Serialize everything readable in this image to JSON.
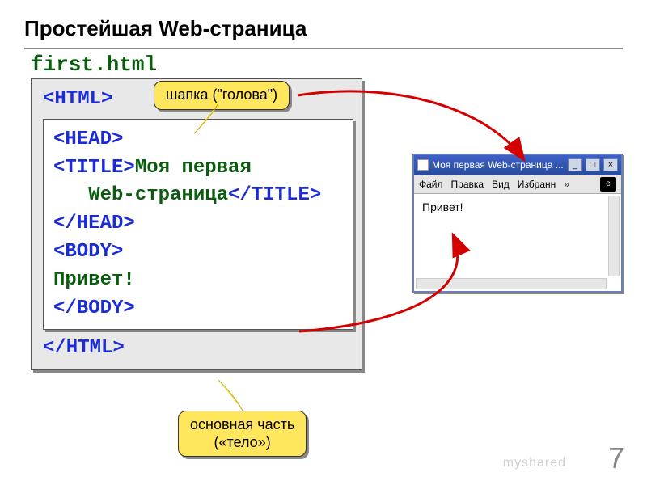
{
  "slide": {
    "title": "Простейшая Web-страница",
    "filename": "first.html",
    "page_number": "7",
    "watermark": "myshared"
  },
  "code": {
    "html_open": "<HTML>",
    "head_open": "<HEAD>",
    "title_open": "<TITLE>",
    "title_text_l1": "Моя первая",
    "title_text_l2": "Web-страница",
    "title_close": "</TITLE>",
    "head_close": "</HEAD>",
    "body_open": "<BODY>",
    "body_text": "Привет!",
    "body_close": "</BODY>",
    "html_close": "</HTML>"
  },
  "callouts": {
    "head": "шапка (\"голова\")",
    "body_l1": "основная часть",
    "body_l2": "(«тело»)"
  },
  "browser": {
    "title": "Моя первая Web-страница ...",
    "menu": {
      "file": "Файл",
      "edit": "Правка",
      "view": "Вид",
      "favorites": "Избранн",
      "chevrons": "»"
    },
    "content": "Привет!"
  }
}
